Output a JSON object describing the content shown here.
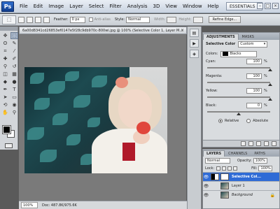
{
  "app": {
    "logo": "Ps",
    "menu": [
      "File",
      "Edit",
      "Image",
      "Layer",
      "Select",
      "Filter",
      "Analysis",
      "3D",
      "View",
      "Window",
      "Help"
    ],
    "zoom": "100%",
    "workspace": "ESSENTIALS"
  },
  "options": {
    "feather_label": "Feather:",
    "feather_value": "0 px",
    "anti_alias_label": "Anti-alias",
    "style_label": "Style:",
    "style_value": "Normal",
    "width_label": "Width:",
    "height_label": "Height:",
    "refine_edge": "Refine Edge..."
  },
  "document": {
    "tab_title": "6a00d8341cd26853ef0147e5f28c9db970c-800wi.jpg @ 100% (Selective Color 1, Layer M...",
    "status_zoom": "100%",
    "status_doc": "Doc: 487.8K/975.6K"
  },
  "adjustments": {
    "tab_label": "ADJUSTMENTS",
    "tab_masks": "MASKS",
    "title": "Selective Color",
    "preset": "Custom",
    "colors_label": "Colors:",
    "colors_value": "Blacks",
    "sliders": [
      {
        "label": "Cyan:",
        "value": "100",
        "unit": "%",
        "level": 1.0
      },
      {
        "label": "Magenta:",
        "value": "100",
        "unit": "%",
        "level": 1.0
      },
      {
        "label": "Yellow:",
        "value": "100",
        "unit": "%",
        "level": 1.0
      },
      {
        "label": "Black:",
        "value": "0",
        "unit": "%",
        "level": 0.5
      }
    ],
    "relative_label": "Relative",
    "absolute_label": "Absolute"
  },
  "layers": {
    "tabs": [
      "LAYERS",
      "CHANNELS",
      "PATHS"
    ],
    "blend_mode": "Normal",
    "opacity_label": "Opacity:",
    "opacity_value": "100%",
    "lock_label": "Lock:",
    "fill_label": "Fill:",
    "fill_value": "100%",
    "items": [
      {
        "name": "Selective Col...",
        "selected": true
      },
      {
        "name": "Layer 1",
        "selected": false
      },
      {
        "name": "Background",
        "selected": false
      }
    ]
  }
}
